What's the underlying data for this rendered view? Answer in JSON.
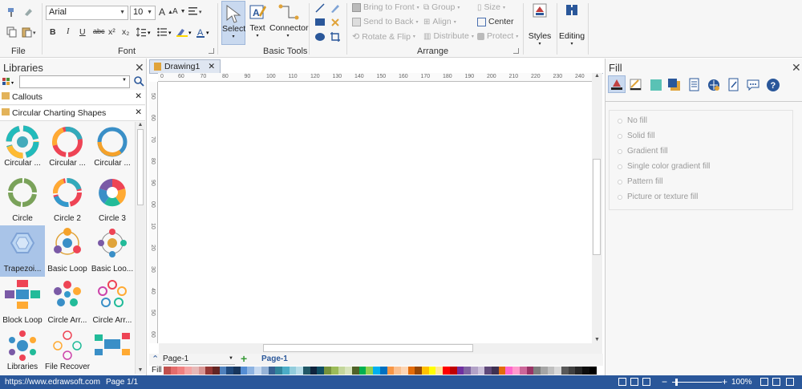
{
  "ribbon": {
    "file_label": "File",
    "font_label": "Font",
    "font_name": "Arial",
    "font_size": "10",
    "basic_tools_label": "Basic Tools",
    "select_label": "Select",
    "text_label": "Text",
    "connector_label": "Connector",
    "arrange_label": "Arrange",
    "bring_to_front": "Bring to Front",
    "send_to_back": "Send to Back",
    "rotate_flip": "Rotate & Flip",
    "group": "Group",
    "align": "Align",
    "distribute": "Distribute",
    "size": "Size",
    "center": "Center",
    "protect": "Protect",
    "styles_label": "Styles",
    "editing_label": "Editing",
    "format_buttons": [
      "B",
      "I",
      "U",
      "abc",
      "x²",
      "x₂"
    ]
  },
  "libraries": {
    "title": "Libraries",
    "search_placeholder": "",
    "categories": [
      "Callouts",
      "Circular Charting Shapes"
    ],
    "shapes": [
      {
        "label": "Circular ..."
      },
      {
        "label": "Circular ..."
      },
      {
        "label": "Circular ..."
      },
      {
        "label": "Circle"
      },
      {
        "label": "Circle 2"
      },
      {
        "label": "Circle 3"
      },
      {
        "label": "Trapezoi..."
      },
      {
        "label": "Basic Loop"
      },
      {
        "label": "Basic Loo..."
      },
      {
        "label": "Block Loop"
      },
      {
        "label": "Circle Arr..."
      },
      {
        "label": "Circle Arr..."
      },
      {
        "label": "Libraries"
      },
      {
        "label": "File Recovery"
      },
      {
        "label": ""
      }
    ]
  },
  "document": {
    "tab_title": "Drawing1",
    "ruler_h": [
      "0",
      "60",
      "70",
      "80",
      "90",
      "100",
      "110",
      "120",
      "130",
      "140",
      "150",
      "160",
      "170",
      "180",
      "190",
      "200",
      "210",
      "220",
      "230",
      "240"
    ],
    "ruler_v": [
      "50",
      "60",
      "70",
      "80",
      "90",
      "00",
      "10",
      "20",
      "30",
      "40",
      "50",
      "60"
    ],
    "page_selector": "Page-1",
    "active_page": "Page-1",
    "fill_label": "Fill"
  },
  "fill_panel": {
    "title": "Fill",
    "options": [
      "No fill",
      "Solid fill",
      "Gradient fill",
      "Single color gradient fill",
      "Pattern fill",
      "Picture or texture fill"
    ]
  },
  "status": {
    "url": "https://www.edrawsoft.com",
    "page": "Page 1/1",
    "zoom": "100%"
  },
  "palette": [
    "#c0504d",
    "#e46c6c",
    "#f08080",
    "#f4a3a3",
    "#e6b8b7",
    "#d99694",
    "#953735",
    "#632523",
    "#4f81bd",
    "#1f497d",
    "#17365d",
    "#548dd4",
    "#8db3e2",
    "#c6d9f0",
    "#95b3d7",
    "#366092",
    "#31859c",
    "#4bacc6",
    "#92cddc",
    "#b7dde8",
    "#215867",
    "#0f243e",
    "#0e4d64",
    "#76923c",
    "#9bbb59",
    "#c3d69b",
    "#d7e4bc",
    "#4f6228",
    "#00b050",
    "#92d050",
    "#00b0f0",
    "#0070c0",
    "#f79646",
    "#fac090",
    "#fcd5b4",
    "#e36c09",
    "#974806",
    "#ffc000",
    "#ffff00",
    "#ffe599",
    "#ff0000",
    "#c00000",
    "#7030a0",
    "#8064a2",
    "#b2a2c7",
    "#ccc1da",
    "#5f497a",
    "#3f3151",
    "#e26b0a",
    "#ff66cc",
    "#ff99cc",
    "#cc6699",
    "#993366",
    "#7f7f7f",
    "#a5a5a5",
    "#bfbfbf",
    "#d8d8d8",
    "#595959",
    "#404040",
    "#262626",
    "#0d0d0d",
    "#000000",
    "#ffffff"
  ]
}
